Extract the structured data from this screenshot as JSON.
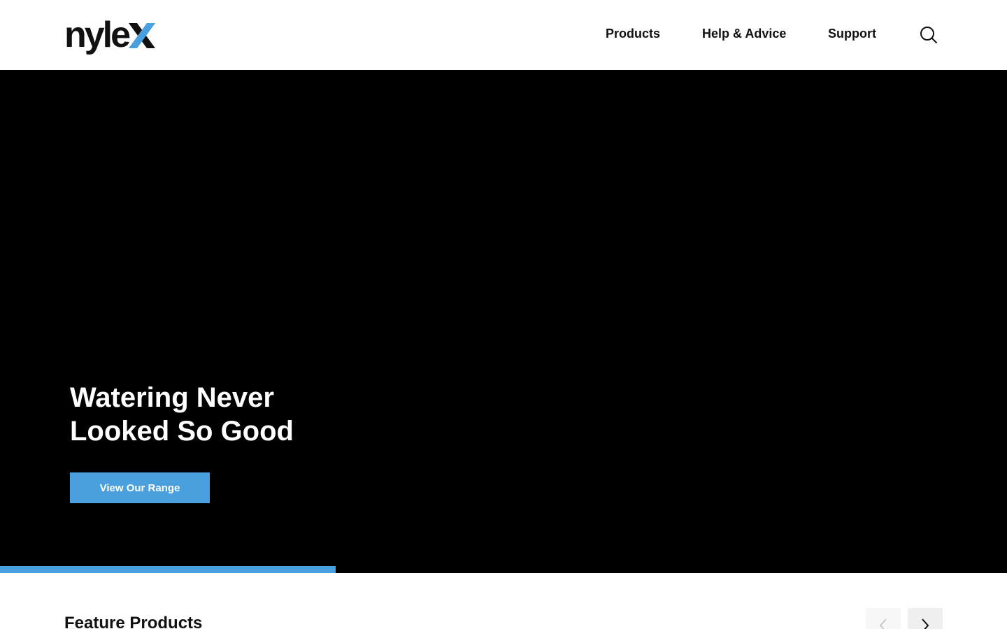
{
  "brand": {
    "logo_text": "nyle",
    "logo_accent_letter": "x",
    "accent_color": "#4aa0df",
    "logo_color": "#111111"
  },
  "nav": {
    "items": [
      {
        "label": "Products"
      },
      {
        "label": "Help & Advice"
      },
      {
        "label": "Support"
      }
    ],
    "search_icon": "search-icon"
  },
  "hero": {
    "title": "Watering Never Looked So Good",
    "cta_label": "View Our Range",
    "background_color": "#000000",
    "slide_progress_percent": 33.3
  },
  "featured": {
    "title": "Feature Products",
    "prev_icon": "chevron-left-icon",
    "next_icon": "chevron-right-icon"
  }
}
